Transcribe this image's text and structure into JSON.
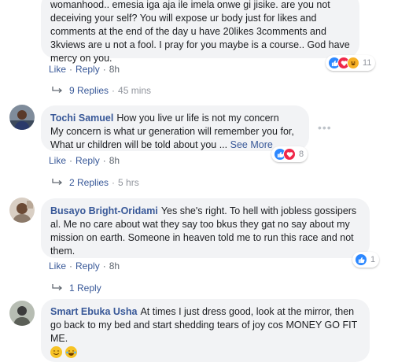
{
  "comments": [
    {
      "author": "",
      "text_lines": [
        "womanhood.. emesia iga aja ile imela onwe gi jisike. are you not",
        "deceiving your self? You will expose ur body just for likes and",
        "comments at the end of the day u have 20likes 3comments and",
        "3kviews are u not a fool. I pray for you maybe is a course.. God have",
        "mercy on you."
      ],
      "actions": {
        "like": "Like",
        "reply": "Reply",
        "time": "8h"
      },
      "reactions": {
        "count": "11",
        "icons": [
          "like-icon",
          "love-icon",
          "haha-icon"
        ]
      },
      "replies": {
        "label": "9 Replies",
        "when": "45 mins"
      }
    },
    {
      "author": "Tochi Samuel",
      "text_first": "How you live ur life is not my concern",
      "text_lines": [
        "My concern is what ur generation will remember you for,",
        "What ur children will be told about you ..."
      ],
      "see_more": "See More",
      "actions": {
        "like": "Like",
        "reply": "Reply",
        "time": "8h"
      },
      "reactions": {
        "count": "8",
        "icons": [
          "like-icon",
          "love-icon"
        ]
      },
      "replies": {
        "label": "2 Replies",
        "when": "5 hrs"
      }
    },
    {
      "author": "Busayo Bright-Oridami",
      "text_first": "Yes she's right. To hell with jobless gossipers",
      "text_lines": [
        "al. Me no care about wat they say too bkus they gat no say about my",
        "mission on earth. Someone in heaven told me to run this race and not",
        "them."
      ],
      "actions": {
        "like": "Like",
        "reply": "Reply",
        "time": "8h"
      },
      "reactions": {
        "count": "1",
        "icons": [
          "like-icon"
        ]
      },
      "replies": {
        "label": "1 Reply",
        "when": ""
      }
    },
    {
      "author": "Smart Ebuka Usha",
      "text_first": "At times I just dress good, look at the mirror, then",
      "text_lines": [
        "go back to my bed and start shedding tears of joy cos MONEY GO FIT",
        "ME."
      ],
      "emojis": [
        "smiling-face-emoji",
        "tears-of-joy-emoji"
      ]
    }
  ],
  "colors": {
    "link": "#385898",
    "bubble": "#f2f3f5",
    "meta": "#606770",
    "like": "#2d88ff",
    "love": "#f0284a",
    "haha": "#f7b125"
  }
}
